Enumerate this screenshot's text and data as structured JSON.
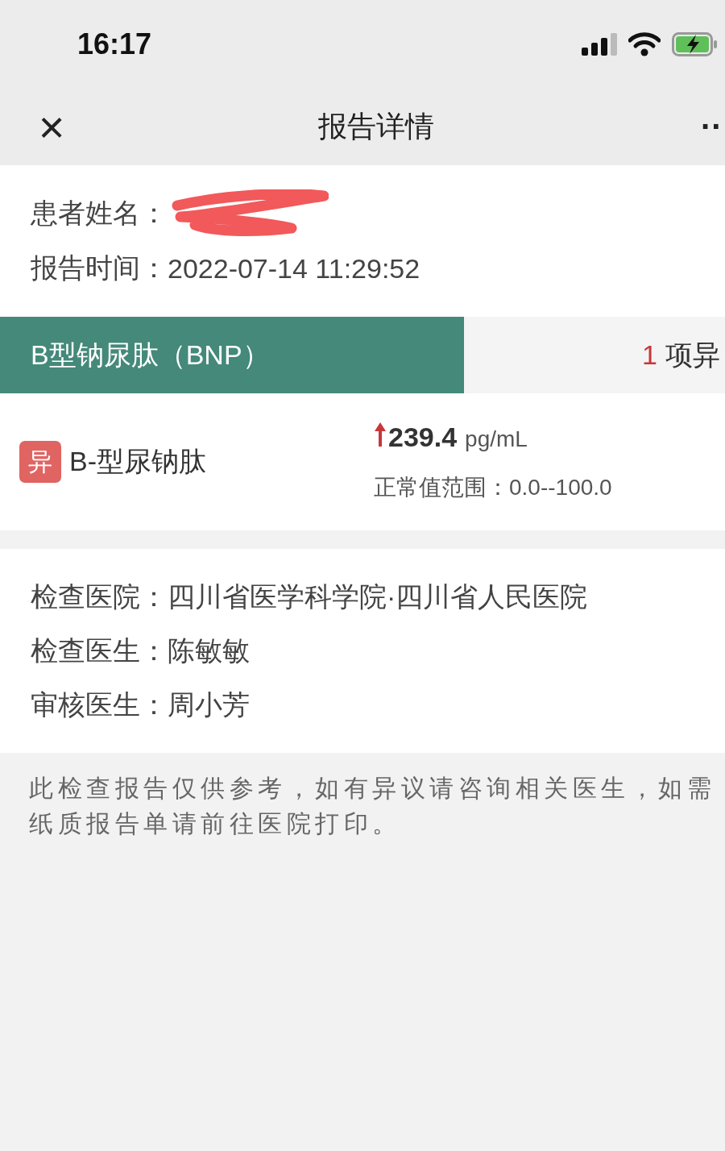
{
  "status_bar": {
    "time": "16:17"
  },
  "nav": {
    "title": "报告详情",
    "close": "×",
    "more": "··"
  },
  "patient": {
    "name_label": "患者姓名：",
    "name_redacted": true,
    "time_label": "报告时间：",
    "time": "2022-07-14 11:29:52"
  },
  "tabs": [
    {
      "label": "B型钠尿肽（BNP）",
      "selected": true
    },
    {
      "count": "1",
      "label": "项异",
      "selected": false
    }
  ],
  "results": [
    {
      "badge": "异",
      "abnormal": true,
      "name": "B-型尿钠肽",
      "high": true,
      "value": "239.4",
      "unit": "pg/mL",
      "range_label": "正常值范围：",
      "range": "0.0--100.0"
    }
  ],
  "details": [
    {
      "label": "检查医院：",
      "value": "四川省医学科学院·四川省人民医院"
    },
    {
      "label": "检查医生：",
      "value": "陈敏敏"
    },
    {
      "label": "审核医生：",
      "value": "周小芳"
    }
  ],
  "footer_note": "此检查报告仅供参考，如有异议请咨询相关医生，如需纸质报告单请前往医院打印。"
}
